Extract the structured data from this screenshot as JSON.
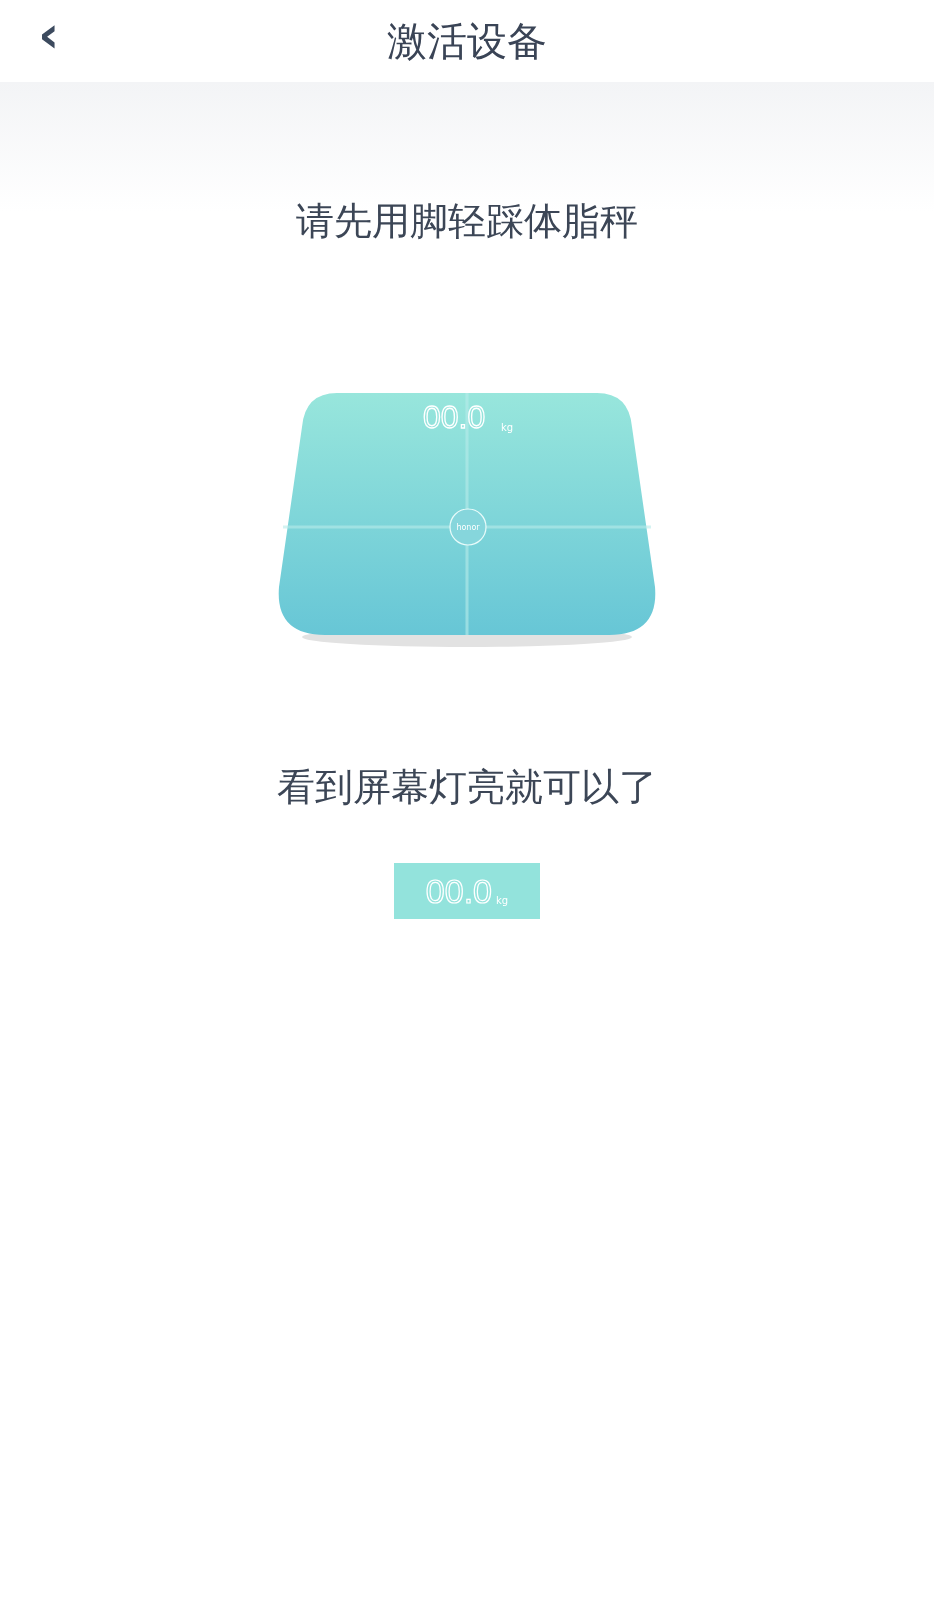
{
  "header": {
    "back_icon": "‹",
    "title": "激活设备"
  },
  "instruction": "请先用脚轻踩体脂秤",
  "scale": {
    "reading": "00.0",
    "unit": "kg",
    "logo_text": "honor"
  },
  "hint": "看到屏幕灯亮就可以了",
  "display": {
    "reading": "00.0",
    "unit": "kg"
  }
}
